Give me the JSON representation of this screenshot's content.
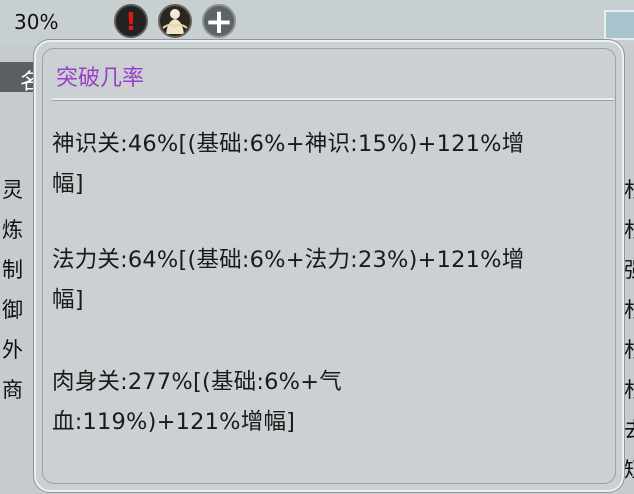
{
  "topbar": {
    "progress_text": "30%",
    "icons": [
      "alert-icon",
      "cultivator-avatar-icon",
      "plus-icon"
    ],
    "alert_glyph": "!",
    "plus_glyph": "+"
  },
  "background": {
    "left_chars": [
      "灵",
      "炼",
      "制",
      "御",
      "外",
      "商"
    ],
    "right_chars": [
      "杉",
      "杉",
      "强",
      "杉",
      "杉",
      "杉",
      "去",
      "短"
    ],
    "tab_char": "名"
  },
  "panel": {
    "title": "突破几率",
    "lines": [
      "神识关:46%[(基础:6%+神识:15%)+121%增",
      "幅]",
      "法力关:64%[(基础:6%+法力:23%)+121%增",
      "幅]",
      "肉身关:277%[(基础:6%+气",
      "血:119%)+121%增幅]"
    ]
  },
  "colors": {
    "title": "#9a3fc8",
    "panel_bg": "#cbd0d2",
    "alert": "#e01818"
  }
}
